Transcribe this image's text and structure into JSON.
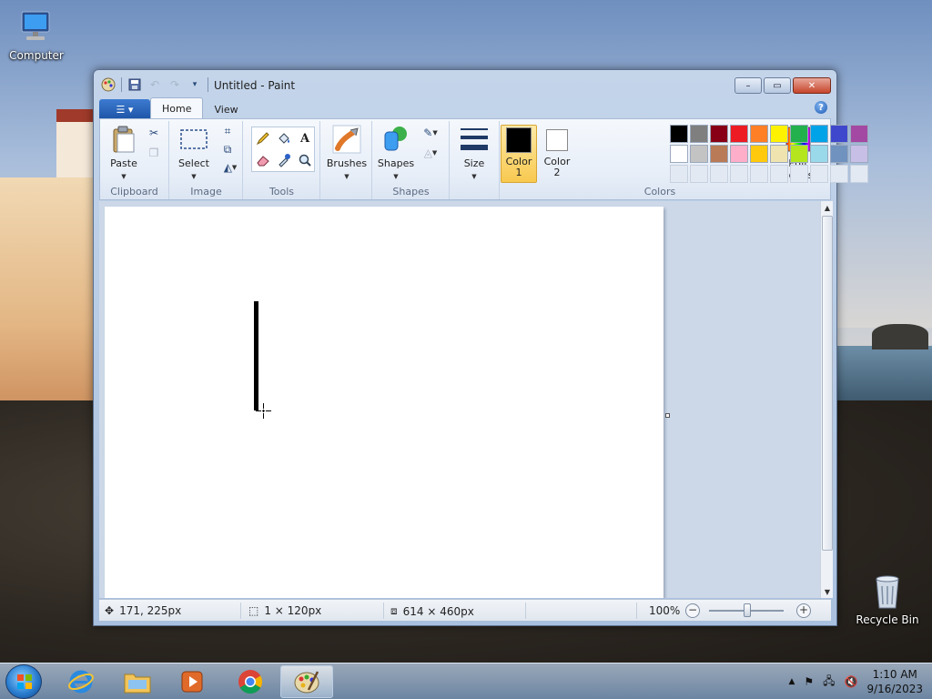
{
  "desktop": {
    "icons": [
      {
        "label": "Computer"
      },
      {
        "label": "Recycle Bin"
      }
    ]
  },
  "window": {
    "title": "Untitled - Paint",
    "controls": {
      "minimize": "–",
      "maximize": "▭",
      "close": "✕"
    }
  },
  "ribbon": {
    "app_menu_label": "☰ ▾",
    "tabs": [
      {
        "label": "Home",
        "active": true
      },
      {
        "label": "View",
        "active": false
      }
    ],
    "groups": {
      "clipboard": {
        "label": "Clipboard",
        "paste": "Paste"
      },
      "image": {
        "label": "Image",
        "select": "Select"
      },
      "tools": {
        "label": "Tools"
      },
      "brushes": {
        "label": "Brushes"
      },
      "shapes": {
        "label": "Shapes",
        "shapes_btn": "Shapes"
      },
      "size": {
        "label": "Size"
      },
      "colors": {
        "label": "Colors",
        "color1": {
          "line1": "Color",
          "line2": "1",
          "value": "#000000"
        },
        "color2": {
          "line1": "Color",
          "line2": "2",
          "value": "#ffffff"
        },
        "edit_colors": {
          "line1": "Edit",
          "line2": "colors"
        },
        "palette_row1": [
          "#000000",
          "#7f7f7f",
          "#880015",
          "#ed1c24",
          "#ff7f27",
          "#fff200",
          "#22b14c",
          "#00a2e8",
          "#3f48cc",
          "#a349a4"
        ],
        "palette_row2": [
          "#ffffff",
          "#c3c3c3",
          "#b97a57",
          "#ffaec9",
          "#ffc90e",
          "#efe4b0",
          "#b5e61d",
          "#99d9ea",
          "#7092be",
          "#c8bfe7"
        ]
      }
    }
  },
  "statusbar": {
    "cursor_pos": "171, 225px",
    "selection_size": "1 × 120px",
    "canvas_size": "614 × 460px",
    "zoom": "100%",
    "zoom_level": 1.0
  },
  "taskbar": {
    "apps": [
      "internet-explorer",
      "file-explorer",
      "media-player",
      "chrome",
      "paint"
    ],
    "clock_time": "1:10 AM",
    "clock_date": "9/16/2023"
  }
}
